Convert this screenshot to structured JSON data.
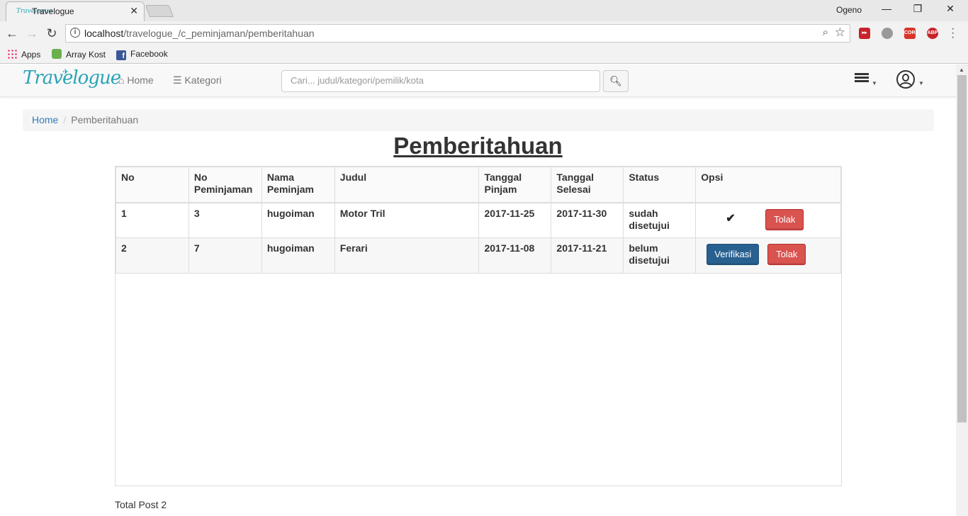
{
  "browser": {
    "tab_title": "Travelogue",
    "tab_favicon_text": "Travelogue",
    "profile_name": "Ogeno",
    "url_host": "localhost",
    "url_path": "/travelogue_/c_peminjaman/pemberitahuan",
    "bookmarks": [
      "Apps",
      "Array Kost",
      "Facebook"
    ],
    "extensions": [
      "CORS",
      "ABP"
    ]
  },
  "navbar": {
    "brand": "Travelogue",
    "home": "Home",
    "kategori": "Kategori",
    "search_placeholder": "Cari... judul/kategori/pemilik/kota"
  },
  "breadcrumb": {
    "home": "Home",
    "current": "Pemberitahuan"
  },
  "page": {
    "title": "Pemberitahuan",
    "total_post": "Total Post 2"
  },
  "table": {
    "headers": {
      "no": "No",
      "no_peminjaman_1": "No",
      "no_peminjaman_2": "Peminjaman",
      "nama_1": "Nama",
      "nama_2": "Peminjam",
      "judul": "Judul",
      "tgl_pinjam_1": "Tanggal",
      "tgl_pinjam_2": "Pinjam",
      "tgl_selesai_1": "Tanggal",
      "tgl_selesai_2": "Selesai",
      "status": "Status",
      "opsi": "Opsi"
    },
    "rows": [
      {
        "no": "1",
        "no_peminjaman": "3",
        "nama": "hugoiman",
        "judul": "Motor Tril",
        "tgl_pinjam": "2017-11-25",
        "tgl_selesai": "2017-11-30",
        "status_1": "sudah",
        "status_2": "disetujui",
        "tolak": "Tolak"
      },
      {
        "no": "2",
        "no_peminjaman": "7",
        "nama": "hugoiman",
        "judul": "Ferari",
        "tgl_pinjam": "2017-11-08",
        "tgl_selesai": "2017-11-21",
        "status_1": "belum",
        "status_2": "disetujui",
        "verifikasi": "Verifikasi",
        "tolak": "Tolak"
      }
    ]
  },
  "colors": {
    "brand": "#2aa3b8",
    "link": "#337ab7",
    "danger": "#d9534f",
    "primary": "#286090"
  }
}
